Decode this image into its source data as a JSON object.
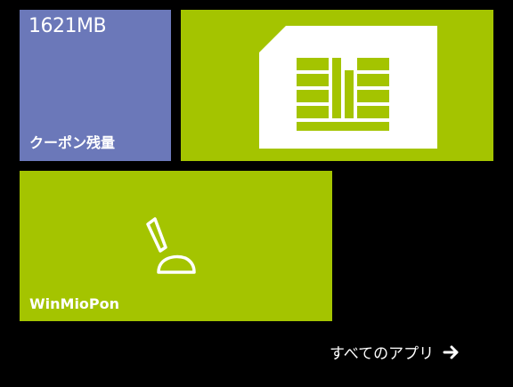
{
  "tiles": {
    "coupon": {
      "count": "1621MB",
      "label": "クーポン残量",
      "color": "#6b78b9"
    },
    "sim": {
      "icon": "sim-card-icon",
      "color": "#a4c400"
    },
    "winmio": {
      "label": "WinMioPon",
      "icon": "joystick-icon",
      "color": "#a4c400"
    }
  },
  "footer": {
    "all_apps_label": "すべてのアプリ",
    "arrow_icon": "arrow-right-icon"
  }
}
